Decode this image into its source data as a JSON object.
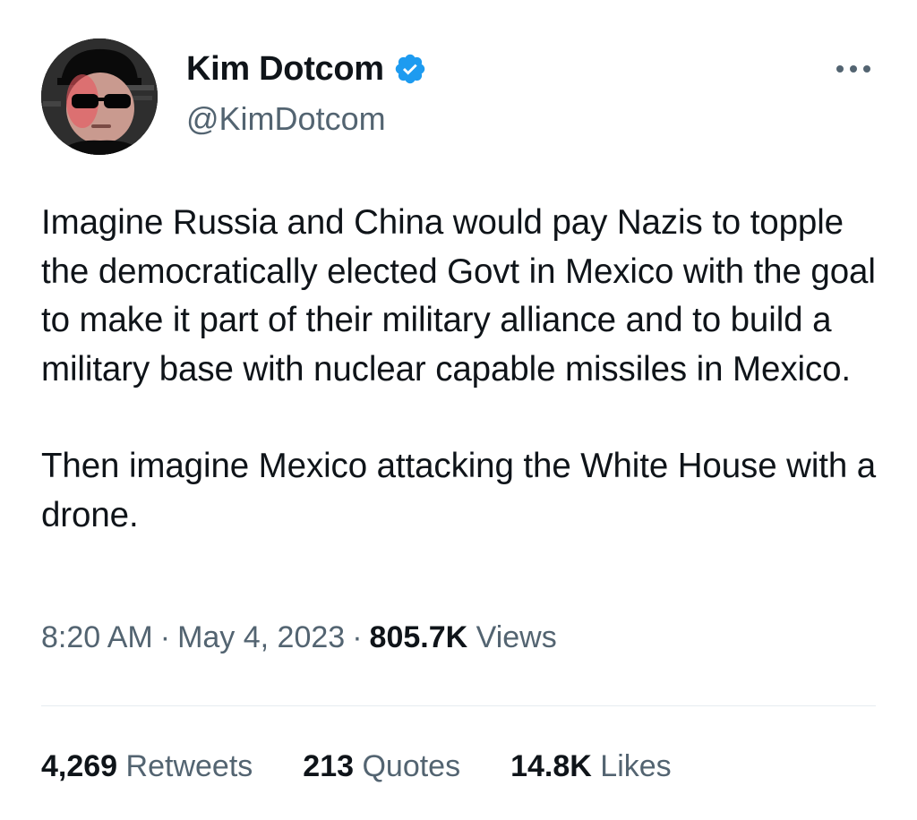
{
  "author": {
    "display_name": "Kim Dotcom",
    "handle": "@KimDotcom",
    "verified": true,
    "verified_icon": "verified-badge-icon",
    "verified_color": "#1d9bf0"
  },
  "menu": {
    "icon": "more-horizontal-icon"
  },
  "tweet": {
    "paragraphs": [
      "Imagine Russia and China would pay Nazis to topple the democratically elected Govt in Mexico with the goal to make it part of their military alliance and to build a military base with nuclear capable missiles in Mexico.",
      "Then imagine Mexico attacking the White House with a drone."
    ]
  },
  "meta": {
    "time": "8:20 AM",
    "separator": "·",
    "date": "May 4, 2023",
    "views_count": "805.7K",
    "views_label": "Views"
  },
  "stats": {
    "retweets_count": "4,269",
    "retweets_label": "Retweets",
    "quotes_count": "213",
    "quotes_label": "Quotes",
    "likes_count": "14.8K",
    "likes_label": "Likes"
  },
  "colors": {
    "text_primary": "#0f1419",
    "text_secondary": "#536471",
    "divider": "#e6ecf0",
    "accent": "#1d9bf0"
  }
}
